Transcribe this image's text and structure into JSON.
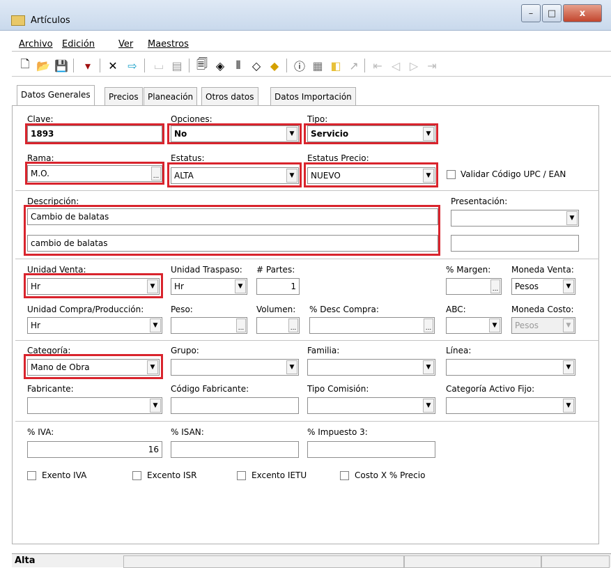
{
  "window": {
    "title": "Artículos",
    "minimize": "–",
    "maximize": "□",
    "close": "x"
  },
  "menu": [
    "Archivo",
    "Edición",
    "Ver",
    "Maestros"
  ],
  "tabs": [
    "Datos Generales",
    "Precios",
    "Planeación",
    "Otros datos",
    "Datos Importación"
  ],
  "form": {
    "clave": {
      "label": "Clave:",
      "value": "1893"
    },
    "opciones": {
      "label": "Opciones:",
      "value": "No"
    },
    "tipo": {
      "label": "Tipo:",
      "value": "Servicio"
    },
    "rama": {
      "label": "Rama:",
      "value": "M.O."
    },
    "estatus": {
      "label": "Estatus:",
      "value": "ALTA"
    },
    "estatus_precio": {
      "label": "Estatus Precio:",
      "value": "NUEVO"
    },
    "validar_upc": "Validar Código UPC / EAN",
    "descripcion": {
      "label": "Descripción:",
      "line1": "Cambio de balatas",
      "line2": "cambio de balatas"
    },
    "presentacion": {
      "label": "Presentación:",
      "value": ""
    },
    "unidad_venta": {
      "label": "Unidad Venta:",
      "value": "Hr"
    },
    "unidad_traspaso": {
      "label": "Unidad Traspaso:",
      "value": "Hr"
    },
    "partes": {
      "label": "# Partes:",
      "value": "1"
    },
    "margen": {
      "label": "% Margen:",
      "value": ""
    },
    "moneda_venta": {
      "label": "Moneda Venta:",
      "value": "Pesos"
    },
    "unidad_compra": {
      "label": "Unidad Compra/Producción:",
      "value": "Hr"
    },
    "peso": {
      "label": "Peso:"
    },
    "volumen": {
      "label": "Volumen:"
    },
    "desc_compra": {
      "label": "% Desc Compra:"
    },
    "abc": {
      "label": "ABC:"
    },
    "moneda_costo": {
      "label": "Moneda Costo:",
      "value": "Pesos"
    },
    "categoria": {
      "label": "Categoría:",
      "value": "Mano de Obra"
    },
    "grupo": {
      "label": "Grupo:"
    },
    "familia": {
      "label": "Familia:"
    },
    "linea": {
      "label": "Línea:"
    },
    "fabricante": {
      "label": "Fabricante:"
    },
    "codigo_fabricante": {
      "label": "Código Fabricante:"
    },
    "tipo_comision": {
      "label": "Tipo Comisión:"
    },
    "categoria_activo": {
      "label": "Categoría Activo Fijo:"
    },
    "iva": {
      "label": "% IVA:",
      "value": "16"
    },
    "isan": {
      "label": "% ISAN:"
    },
    "impuesto3": {
      "label": "% Impuesto 3:"
    },
    "checks": [
      "Exento IVA",
      "Excento ISR",
      "Excento IETU",
      "Costo X % Precio"
    ]
  },
  "status": {
    "mode": "Alta"
  },
  "colors": {
    "highlight": "#d9242d",
    "titlebar": "#c9d9ec"
  }
}
